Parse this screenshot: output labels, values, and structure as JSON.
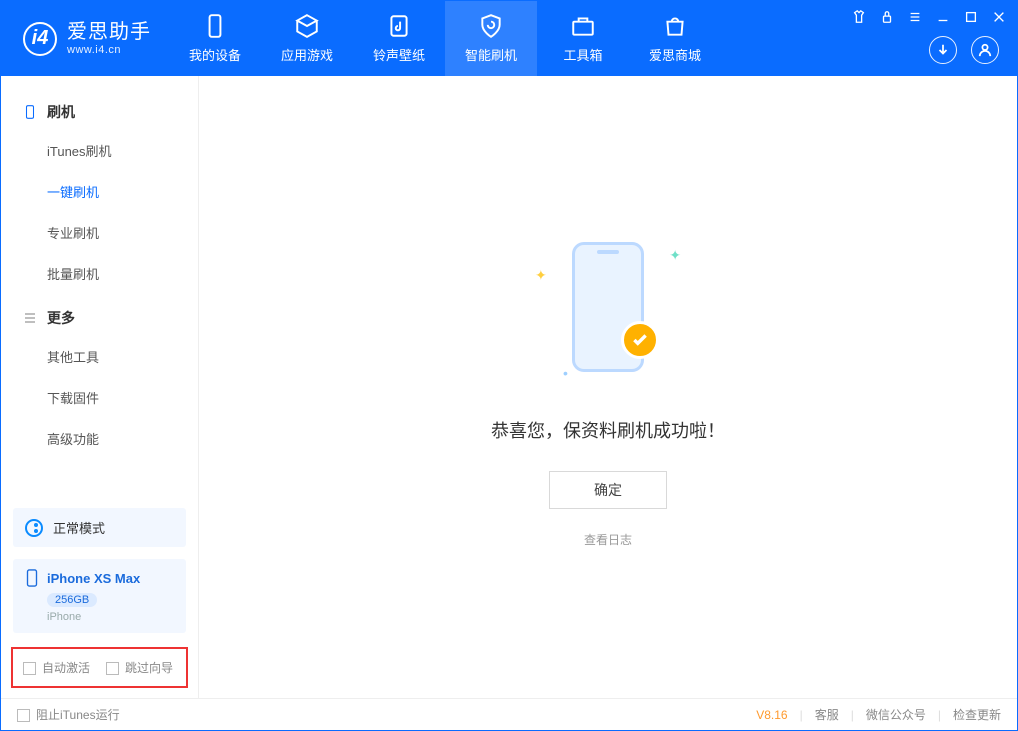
{
  "app": {
    "name_cn": "爱思助手",
    "name_en": "www.i4.cn"
  },
  "nav": {
    "items": [
      {
        "label": "我的设备"
      },
      {
        "label": "应用游戏"
      },
      {
        "label": "铃声壁纸"
      },
      {
        "label": "智能刷机"
      },
      {
        "label": "工具箱"
      },
      {
        "label": "爱思商城"
      }
    ],
    "active_index": 3
  },
  "sidebar": {
    "group1_title": "刷机",
    "group1_items": [
      {
        "label": "iTunes刷机"
      },
      {
        "label": "一键刷机"
      },
      {
        "label": "专业刷机"
      },
      {
        "label": "批量刷机"
      }
    ],
    "group1_active_index": 1,
    "group2_title": "更多",
    "group2_items": [
      {
        "label": "其他工具"
      },
      {
        "label": "下载固件"
      },
      {
        "label": "高级功能"
      }
    ]
  },
  "mode": {
    "label": "正常模式"
  },
  "device": {
    "name": "iPhone XS Max",
    "capacity": "256GB",
    "type": "iPhone"
  },
  "options": {
    "auto_activate": "自动激活",
    "skip_guide": "跳过向导"
  },
  "main": {
    "success_text": "恭喜您，保资料刷机成功啦！",
    "ok_button": "确定",
    "view_log": "查看日志"
  },
  "footer": {
    "block_itunes": "阻止iTunes运行",
    "version": "V8.16",
    "links": [
      "客服",
      "微信公众号",
      "检查更新"
    ]
  }
}
